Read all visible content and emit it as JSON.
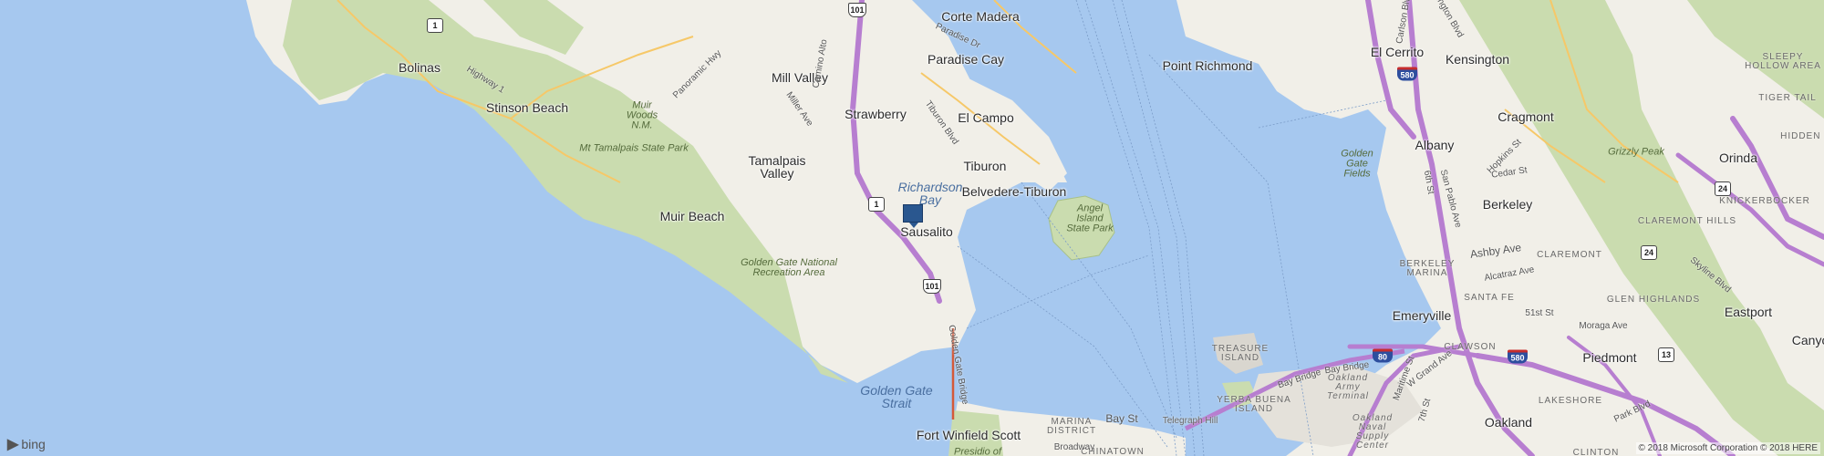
{
  "map": {
    "places": {
      "corte_madera": "Corte Madera",
      "bolinas": "Bolinas",
      "stinson_beach": "Stinson Beach",
      "mill_valley": "Mill Valley",
      "paradise_cay": "Paradise Cay",
      "strawberry": "Strawberry",
      "el_campo": "El Campo",
      "tiburon": "Tiburon",
      "belvedere_tiburon": "Belvedere-Tiburon",
      "tamalpais_valley": "Tamalpais\nValley",
      "muir_beach": "Muir Beach",
      "sausalito": "Sausalito",
      "point_richmond": "Point Richmond",
      "el_cerrito": "El Cerrito",
      "kensington": "Kensington",
      "albany": "Albany",
      "cragmont": "Cragmont",
      "orinda": "Orinda",
      "berkeley": "Berkeley",
      "emeryville": "Emeryville",
      "piedmont": "Piedmont",
      "eastport": "Eastport",
      "canyon": "Canyo",
      "oakland": "Oakland",
      "fort_winfield_scott": "Fort Winfield Scott"
    },
    "water": {
      "richardson_bay": "Richardson\nBay",
      "golden_gate_strait": "Golden Gate\nStrait"
    },
    "parks": {
      "muir_woods": "Muir\nWoods\nN.M.",
      "mt_tam": "Mt Tamalpais State Park",
      "golden_gate_nra": "Golden Gate National\nRecreation Area",
      "angel_island": "Angel\nIsland\nState Park",
      "golden_gate_fields": "Golden\nGate\nFields",
      "grizzly_peak": "Grizzly Peak",
      "presidio": "Presidio of"
    },
    "areas": {
      "sleepy_hollow": "SLEEPY\nHOLLOW AREA",
      "tiger_tail": "TIGER TAIL",
      "hiddenv": "HIDDEN V",
      "knickerbocker": "KNICKERBOCKER",
      "claremont_hills": "CLAREMONT HILLS",
      "claremont": "CLAREMONT",
      "berkeley_marina": "BERKELEY\nMARINA",
      "santa_fe": "SANTA FE",
      "glen_highlands": "GLEN HIGHLANDS",
      "treasure_island": "TREASURE\nISLAND",
      "yerba_buena": "YERBA BUENA\nISLAND",
      "oakland_army": "Oakland\nArmy\nTerminal",
      "oakland_naval": "Oakland\nNaval\nSupply\nCenter",
      "clawson": "CLAWSON",
      "lakeshore": "LAKESHORE",
      "marina_district": "MARINA\nDISTRICT",
      "chinatown": "CHINATOWN",
      "telegraph_hill": "Telegraph Hill",
      "clinton": "CLINTON"
    },
    "streets": {
      "highway1": "Highway 1",
      "panoramic_hwy": "Panoramic Hwy",
      "camino_alto": "Camino Alto",
      "miller_ave": "Miller Ave",
      "paradise_dr": "Paradise Dr",
      "tiburon_blvd": "Tiburon Blvd",
      "golden_gate_bridge": "Golden Gate Bridge",
      "carlson_blvd": "Carlson Blvd",
      "arlington_blvd": "Arlington Blvd",
      "san_pablo_ave": "San Pablo Ave",
      "sixth_st": "6th St",
      "hopkins_st": "Hopkins St",
      "cedar_st": "Cedar St",
      "ashby_ave": "Ashby Ave",
      "alcatraz_ave": "Alcatraz Ave",
      "fifty_first_st": "51st St",
      "moraga_ave": "Moraga Ave",
      "park_blvd": "Park Blvd",
      "skyline_blvd": "Skyline Blvd",
      "bay_bridge": "Bay Bridge",
      "bay_bridge2": "Bay Bridge",
      "grand_ave": "W Grand Ave",
      "maritime_st": "Maritime St",
      "seventh_st": "7th St",
      "bay_st": "Bay St",
      "broadway": "Broadway"
    },
    "shields": {
      "ca1_top": "1",
      "us101_top": "101",
      "ca1_mid": "1",
      "us101_mid": "101",
      "i580_a": "580",
      "i80": "80",
      "i580_b": "580",
      "ca24_a": "24",
      "ca24_b": "24",
      "ca13": "13"
    }
  },
  "brand": {
    "logo_text": "bing"
  },
  "copyright": "© 2018 Microsoft Corporation © 2018 HERE",
  "colors": {
    "water": "#a6c8ef",
    "land": "#f1efe8",
    "park": "#cadcaf",
    "highway": "#b77ed0",
    "pin": "#2a578f"
  }
}
